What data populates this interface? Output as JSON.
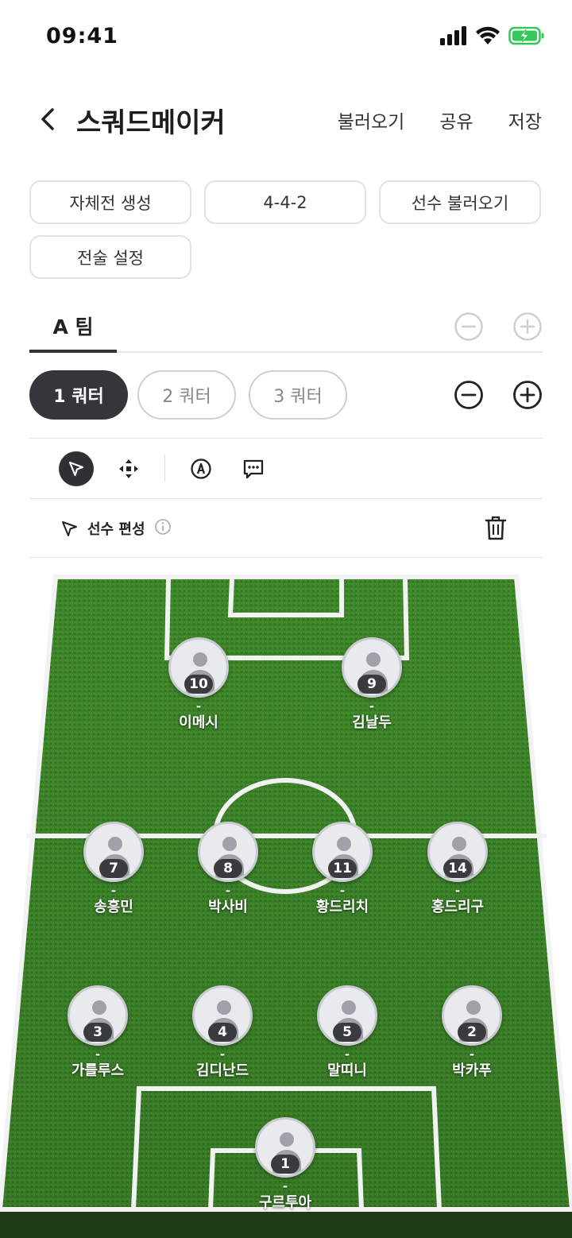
{
  "status_bar": {
    "time": "09:41"
  },
  "header": {
    "title": "스쿼드메이커",
    "actions": [
      "불러오기",
      "공유",
      "저장"
    ]
  },
  "chips": {
    "row1": [
      "자체전 생성",
      "4-4-2",
      "선수 불러오기"
    ],
    "row2": [
      "전술 설정"
    ]
  },
  "team_tab": {
    "label": "A 팀"
  },
  "quarters": [
    "1 쿼터",
    "2 쿼터",
    "3 쿼터"
  ],
  "active_quarter": 0,
  "mode": {
    "label": "선수 편성"
  },
  "colors": {
    "accent_dark": "#34363a",
    "pitch_green": "#3e8a2a",
    "battery_green": "#34c759"
  },
  "players": [
    {
      "number": "10",
      "sub": "-",
      "name": "이메시"
    },
    {
      "number": "9",
      "sub": "-",
      "name": "김날두"
    },
    {
      "number": "7",
      "sub": "-",
      "name": "송흥민"
    },
    {
      "number": "8",
      "sub": "-",
      "name": "박사비"
    },
    {
      "number": "11",
      "sub": "-",
      "name": "황드리치"
    },
    {
      "number": "14",
      "sub": "-",
      "name": "홍드리구"
    },
    {
      "number": "3",
      "sub": "-",
      "name": "가를루스"
    },
    {
      "number": "4",
      "sub": "-",
      "name": "김디난드"
    },
    {
      "number": "5",
      "sub": "-",
      "name": "말띠니"
    },
    {
      "number": "2",
      "sub": "-",
      "name": "박카푸"
    },
    {
      "number": "1",
      "sub": "-",
      "name": "구르투아"
    }
  ]
}
